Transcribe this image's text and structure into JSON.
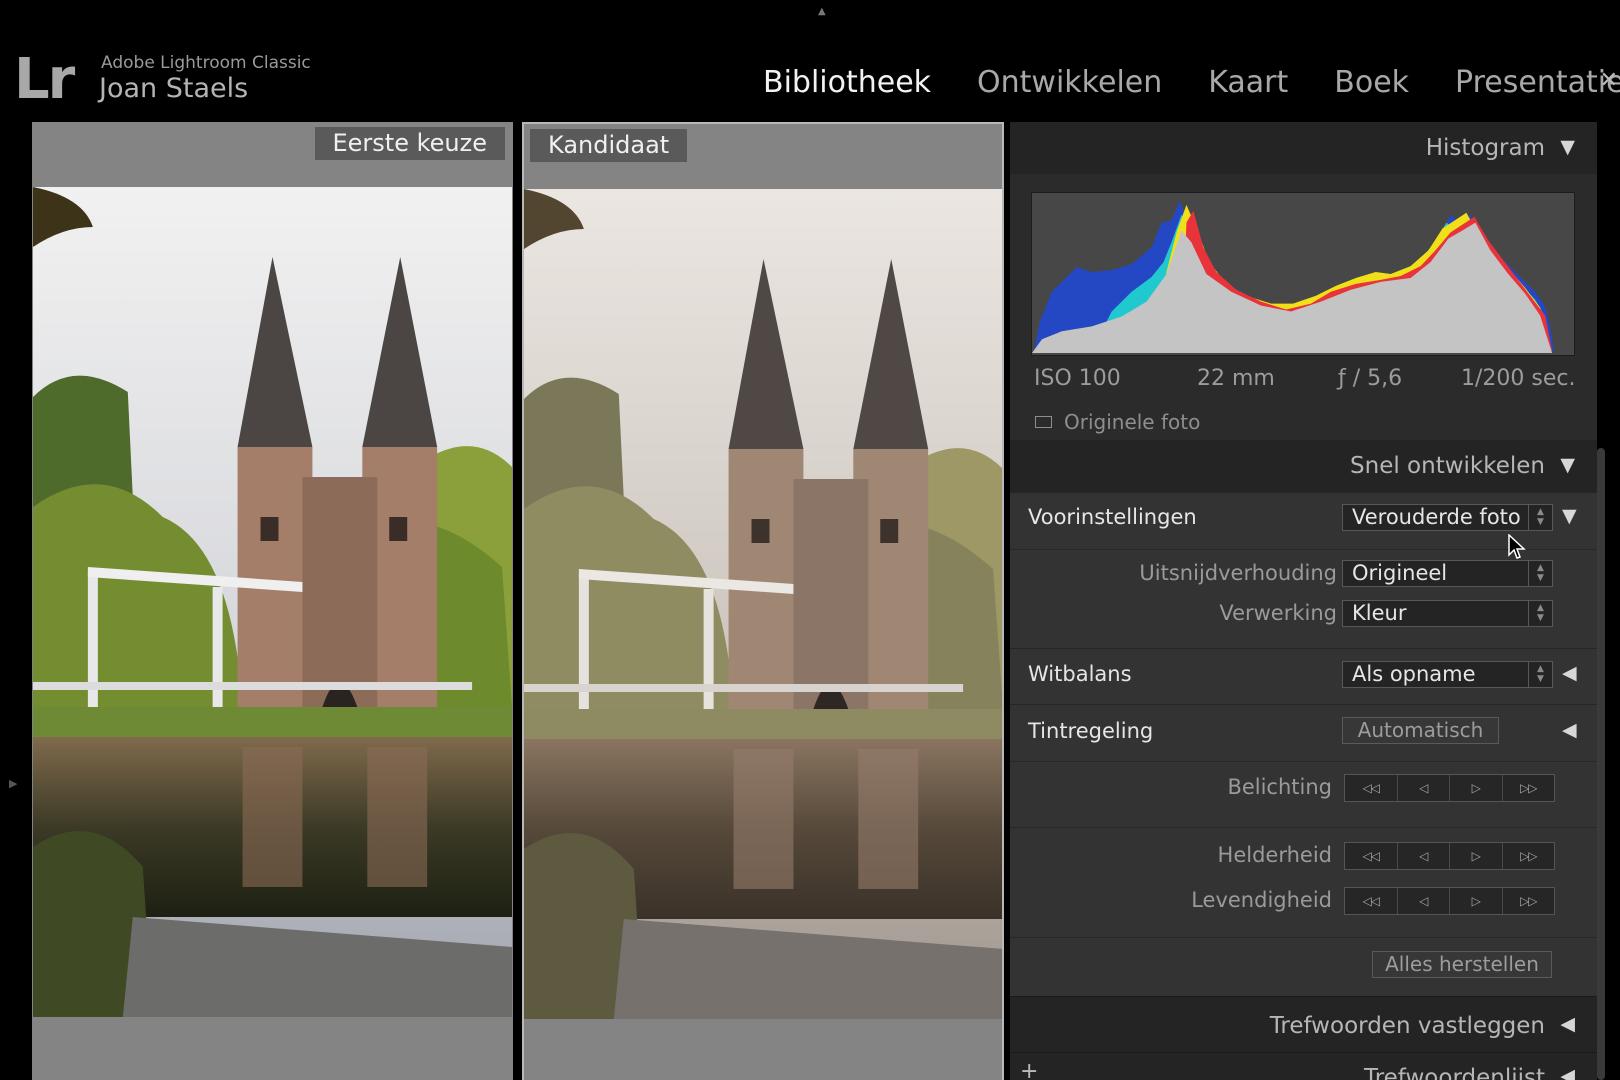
{
  "app": {
    "name": "Adobe Lightroom Classic",
    "user": "Joan Staels",
    "logo_text": "Lr",
    "top_toggle": "▲"
  },
  "modules": [
    {
      "label": "Bibliotheek",
      "active": true
    },
    {
      "label": "Ontwikkelen",
      "active": false
    },
    {
      "label": "Kaart",
      "active": false
    },
    {
      "label": "Boek",
      "active": false
    },
    {
      "label": "Presentatie",
      "active": false
    }
  ],
  "nav_close": "✕",
  "compare": {
    "select_label": "Eerste keuze",
    "candidate_label": "Kandidaat"
  },
  "panels": {
    "histogram": {
      "title": "Histogram",
      "iso": "ISO 100",
      "focal": "22 mm",
      "aperture": "ƒ / 5,6",
      "shutter": "1/200 sec.",
      "original_photo": "Originele foto"
    },
    "quick_develop": {
      "title": "Snel ontwikkelen",
      "presets_label": "Voorinstellingen",
      "presets_value": "Verouderde foto",
      "crop_label": "Uitsnijdverhouding",
      "crop_value": "Origineel",
      "treatment_label": "Verwerking",
      "treatment_value": "Kleur",
      "wb_label": "Witbalans",
      "wb_value": "Als opname",
      "tone_label": "Tintregeling",
      "auto_button": "Automatisch",
      "exposure_label": "Belichting",
      "clarity_label": "Helderheid",
      "vibrance_label": "Levendigheid",
      "reset_button": "Alles herstellen"
    },
    "keywording": {
      "title": "Trefwoorden vastleggen"
    },
    "keyword_list": {
      "title": "Trefwoordenlijst",
      "add": "+"
    }
  },
  "stepper_glyphs": [
    "◁◁",
    "◁",
    "▷",
    "▷▷"
  ],
  "triangles": {
    "open": "▼",
    "closed": "◀"
  },
  "colors": {
    "background": "#000000",
    "panel": "#2f2f2f",
    "pane": "#848484",
    "active_text": "#f2f2f2"
  }
}
